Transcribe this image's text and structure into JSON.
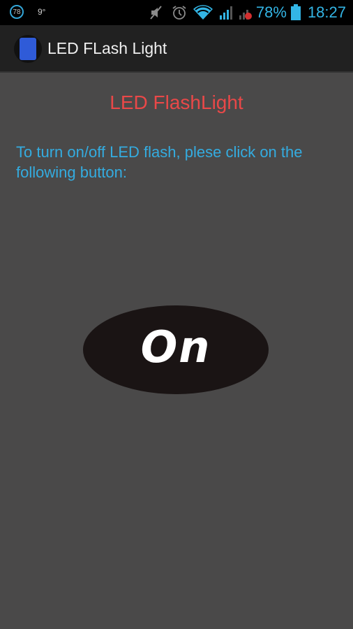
{
  "status_bar": {
    "notification_badge": "78",
    "temperature": "9°",
    "icons": [
      "muted-icon",
      "alarm-icon",
      "wifi-icon",
      "signal-icon",
      "signal-no-sim-icon",
      "battery-icon"
    ],
    "battery_percent": "78%",
    "time": "18:27"
  },
  "action_bar": {
    "title": "LED FLash Light",
    "app_icon": "flashlight-app-icon"
  },
  "main": {
    "headline": "LED FlashLight",
    "instructions": "To turn on/off LED flash, plese click on the following button:",
    "toggle_button_label": "On"
  },
  "colors": {
    "accent_blue": "#33b5e5",
    "headline_red": "#e94848",
    "background": "#4a4949"
  }
}
